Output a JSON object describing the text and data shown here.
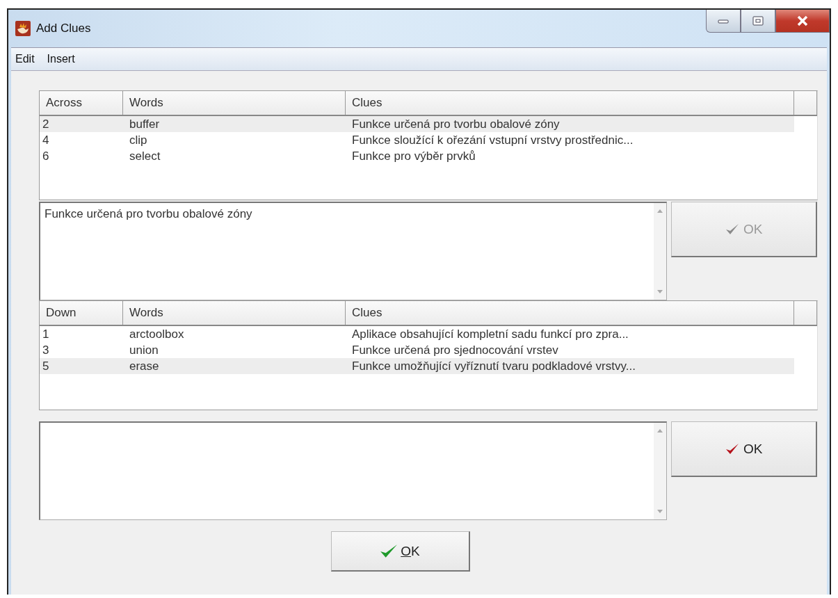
{
  "window": {
    "title": "Add Clues"
  },
  "menu": [
    "Edit",
    "Insert"
  ],
  "across": {
    "columns": [
      "Across",
      "Words",
      "Clues"
    ],
    "rows": [
      {
        "number": "2",
        "word": "buffer",
        "clue": "Funkce určená pro tvorbu obalové zóny",
        "selected": true
      },
      {
        "number": "4",
        "word": "clip",
        "clue": "Funkce sloužící k ořezání vstupní vrstvy prostřednic...",
        "selected": false
      },
      {
        "number": "6",
        "word": "select",
        "clue": "Funkce pro výběr prvků",
        "selected": false
      }
    ],
    "editor": {
      "value": "Funkce určená pro tvorbu obalové zóny"
    },
    "ok_button": {
      "label": "OK",
      "disabled": true
    }
  },
  "down": {
    "columns": [
      "Down",
      "Words",
      "Clues"
    ],
    "rows": [
      {
        "number": "1",
        "word": "arctoolbox",
        "clue": "Aplikace obsahující kompletní sadu funkcí pro zpra...",
        "selected": false
      },
      {
        "number": "3",
        "word": "union",
        "clue": "Funkce určená pro sjednocování vrstev",
        "selected": false
      },
      {
        "number": "5",
        "word": "erase",
        "clue": "Funkce umožňující vyříznutí tvaru podkladové vrstvy...",
        "selected": true
      }
    ],
    "ok_button": {
      "label": "OK",
      "disabled": false
    }
  },
  "main_button": {
    "label": "OK",
    "access_key_underlined": true
  }
}
